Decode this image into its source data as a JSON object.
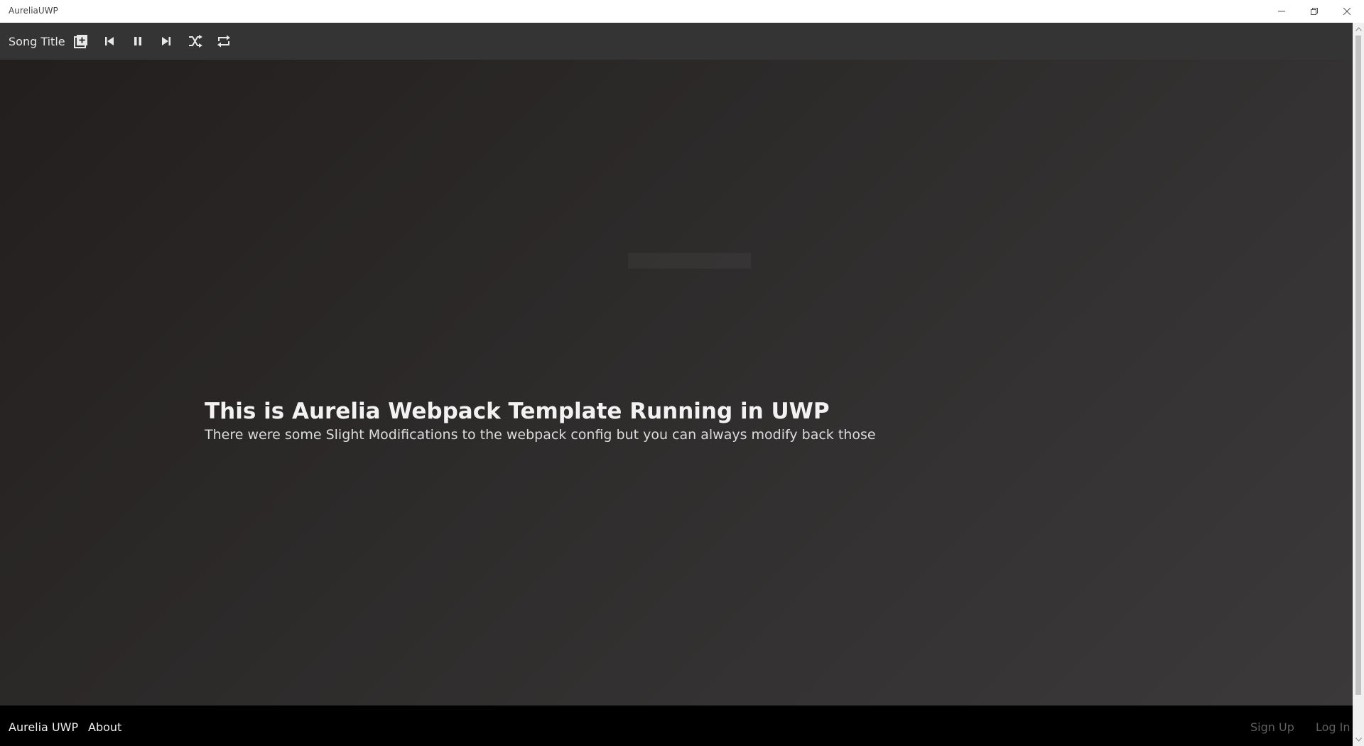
{
  "window": {
    "title": "AureliaUWP",
    "controls": [
      "minimize-icon",
      "restore-icon",
      "close-icon"
    ]
  },
  "toolbar": {
    "song_title": "Song Title",
    "buttons": [
      {
        "name": "add-to-playlist-button",
        "icon": "add-icon"
      },
      {
        "name": "previous-button",
        "icon": "skip-previous-icon"
      },
      {
        "name": "pause-button",
        "icon": "pause-icon"
      },
      {
        "name": "next-button",
        "icon": "skip-next-icon"
      },
      {
        "name": "shuffle-button",
        "icon": "shuffle-icon"
      },
      {
        "name": "repeat-button",
        "icon": "repeat-icon"
      }
    ]
  },
  "main": {
    "heading": "This is Aurelia Webpack Template Running in UWP",
    "subheading": "There were some Slight Modifications to the webpack config but you can always modify back those"
  },
  "footer": {
    "brand": "Aurelia UWP",
    "nav": [
      "About"
    ],
    "auth": {
      "sign_up": "Sign Up",
      "log_in": "Log In"
    }
  },
  "colors": {
    "toolbar_bg": "#343434",
    "footer_bg": "#000000",
    "auth_link": "#5f5f5f"
  }
}
